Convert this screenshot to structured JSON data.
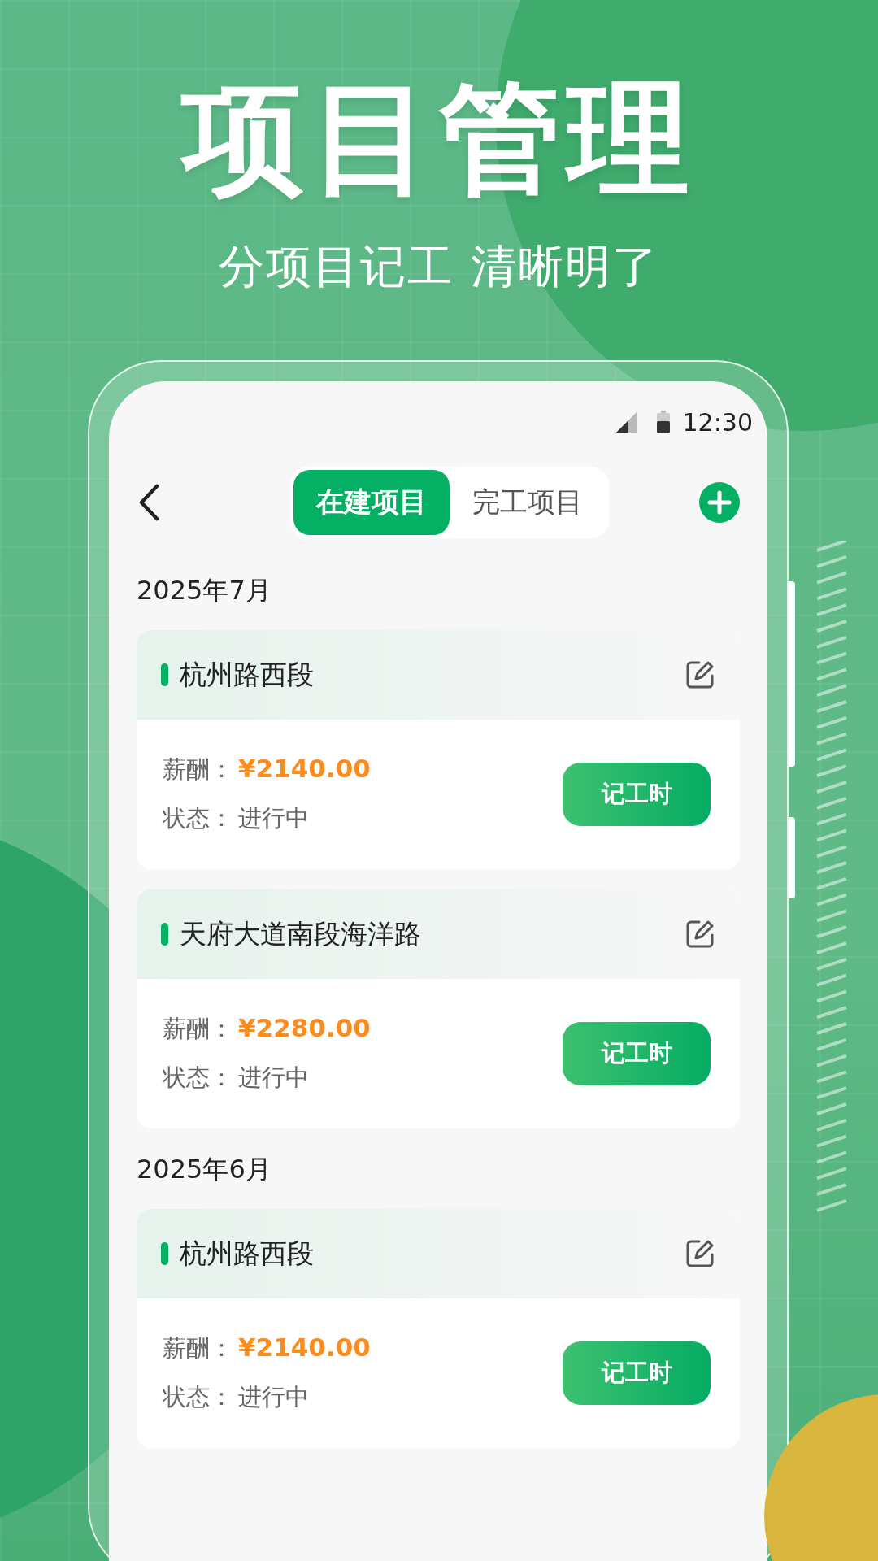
{
  "headline": "项目管理",
  "subtitle": "分项目记工 清晰明了",
  "status_bar": {
    "time": "12:30"
  },
  "tabs": [
    {
      "label": "在建项目",
      "selected": true
    },
    {
      "label": "完工项目",
      "selected": false
    }
  ],
  "sections": [
    {
      "month": "2025年7月",
      "projects": [
        {
          "name": "杭州路西段",
          "salary_label": "薪酬：",
          "salary": "¥2140.00",
          "status_label": "状态：",
          "status": "进行中",
          "button": "记工时"
        },
        {
          "name": "天府大道南段海洋路",
          "salary_label": "薪酬：",
          "salary": "¥2280.00",
          "status_label": "状态：",
          "status": "进行中",
          "button": "记工时"
        }
      ]
    },
    {
      "month": "2025年6月",
      "projects": [
        {
          "name": "杭州路西段",
          "salary_label": "薪酬：",
          "salary": "¥2140.00",
          "status_label": "状态：",
          "status": "进行中",
          "button": "记工时"
        }
      ]
    }
  ]
}
